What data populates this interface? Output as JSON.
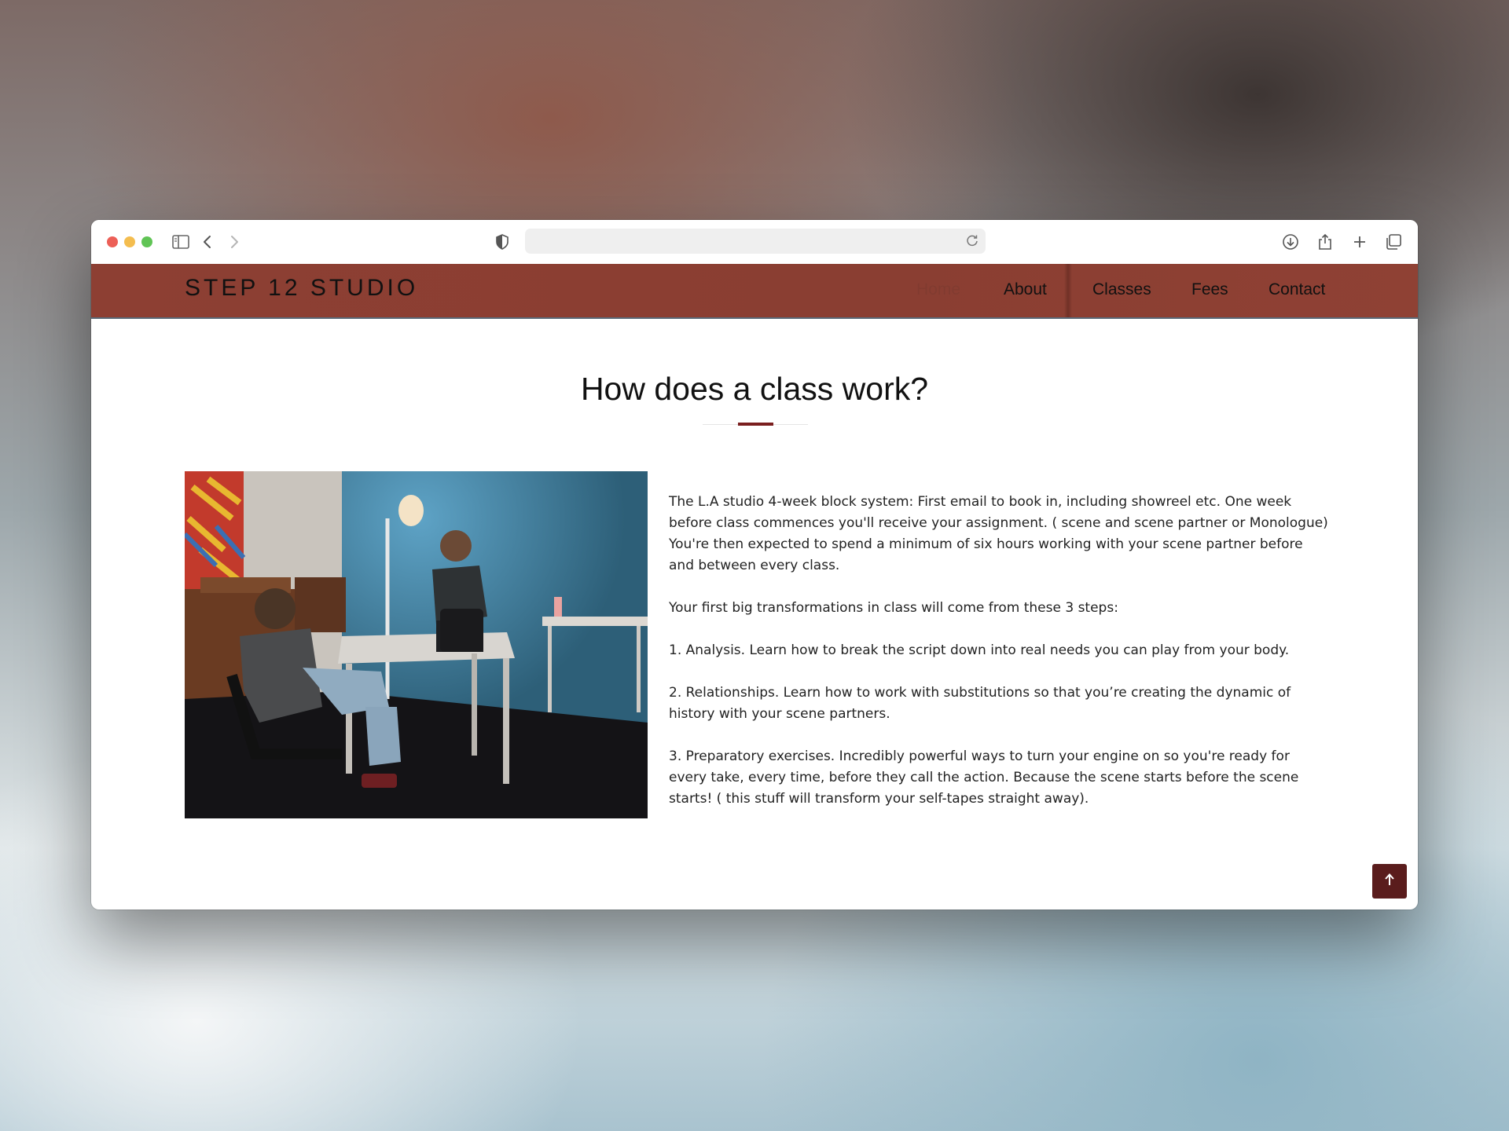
{
  "browser": {
    "address_text": "",
    "icons": [
      "sidebar-icon",
      "back-icon",
      "forward-icon",
      "shield-icon",
      "reload-icon",
      "download-icon",
      "share-icon",
      "new-tab-icon",
      "tabs-overview-icon"
    ]
  },
  "site": {
    "brand": "STEP 12 STUDIO",
    "nav": [
      {
        "label": "Home",
        "active": true
      },
      {
        "label": "About"
      },
      {
        "label": "Classes"
      },
      {
        "label": "Fees"
      },
      {
        "label": "Contact"
      }
    ],
    "accent_color": "#8d3f33",
    "divider_color": "#7a1e1e"
  },
  "main": {
    "heading": "How does a class work?",
    "paragraphs": [
      "The L.A studio 4-week block system: First email to book in, including showreel etc. One week before class commences you'll receive your assignment. ( scene and scene partner or Monologue) You're then expected to spend a minimum of six hours working with your scene partner before and between every class.",
      "Your first big transformations in class will come from these 3 steps:",
      "1. Analysis. Learn how to break the script down into real needs you can play from your body.",
      "2. Relationships. Learn how to work with substitutions so that you’re creating the dynamic of history with your scene partners.",
      "3. Preparatory exercises. Incredibly powerful ways to turn your engine on so you're ready for every take, every time, before they call the action. Because the scene starts before the scene starts! ( this stuff will transform your self-tapes straight away)."
    ]
  },
  "back_to_top": {
    "icon": "arrow-up-icon",
    "color": "#5a1c1c"
  }
}
